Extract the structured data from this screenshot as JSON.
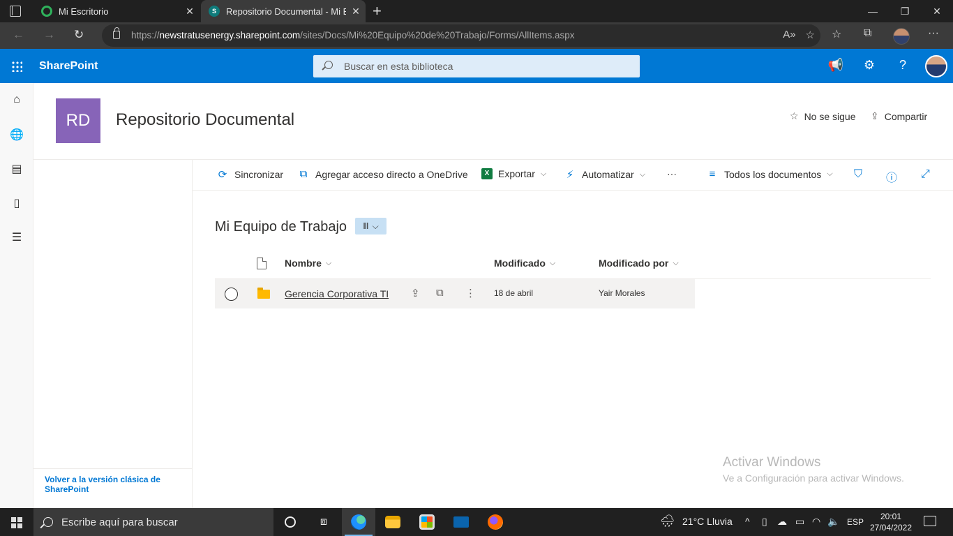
{
  "browser": {
    "tabs": [
      {
        "title": "Mi Escritorio"
      },
      {
        "title": "Repositorio Documental - Mi Eq"
      }
    ],
    "url_prefix": "https://",
    "url_host": "newstratusenergy.sharepoint.com",
    "url_path": "/sites/Docs/Mi%20Equipo%20de%20Trabajo/Forms/AllItems.aspx"
  },
  "suite": {
    "app_name": "SharePoint",
    "search_placeholder": "Buscar en esta biblioteca"
  },
  "site": {
    "logo_initials": "RD",
    "title": "Repositorio Documental",
    "follow_label": "No se sigue",
    "share_label": "Compartir"
  },
  "commands": {
    "sync": "Sincronizar",
    "shortcut": "Agregar acceso directo a OneDrive",
    "export": "Exportar",
    "automate": "Automatizar",
    "more": "···",
    "view": "Todos los documentos"
  },
  "library": {
    "title": "Mi Equipo de Trabajo",
    "columns": {
      "name": "Nombre",
      "modified": "Modificado",
      "modified_by": "Modificado por"
    },
    "rows": [
      {
        "name": "Gerencia Corporativa TI",
        "modified": "18 de abril",
        "modified_by": "Yair Morales"
      }
    ]
  },
  "leftnav": {
    "classic_link": "Volver a la versión clásica de SharePoint"
  },
  "watermark": {
    "line1": "Activar Windows",
    "line2": "Ve a Configuración para activar Windows."
  },
  "taskbar": {
    "search_placeholder": "Escribe aquí para buscar",
    "weather": "21°C  Lluvia",
    "language": "ESP",
    "time": "20:01",
    "date": "27/04/2022"
  },
  "colors": {
    "suite_bar": "#0078d4",
    "site_logo": "#8764b8",
    "library_badge": "#c7e0f4"
  }
}
